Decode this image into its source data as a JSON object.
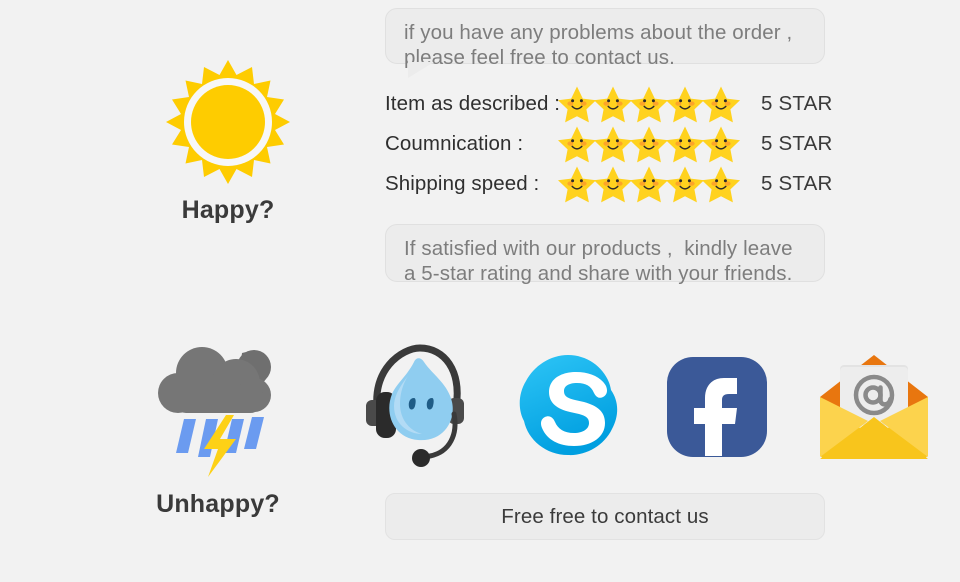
{
  "page": {
    "background_color": "#f2f2f2"
  },
  "top_bubble": {
    "name": "problems-notice",
    "line1": "if you have any problems about the order ,",
    "line2": "please feel free to contact us."
  },
  "mood": {
    "happy": {
      "label": "Happy?",
      "icon": "sun-icon",
      "color": "#fecc00"
    },
    "unhappy": {
      "label": "Unhappy?",
      "icon": "storm-cloud-rain-icon",
      "cloud_color": "#767676",
      "rain_color": "#6b9bf0",
      "bolt_color": "#fdd116"
    }
  },
  "ratings": {
    "star_glyph": "smiling-star-icon",
    "star_count": 5,
    "star_color": "#ffd21e",
    "rows": [
      {
        "label": "Item as described :",
        "stars": 5,
        "value": "5 STAR"
      },
      {
        "label": "Coumnication :",
        "stars": 5,
        "value": "5 STAR"
      },
      {
        "label": "Shipping speed :",
        "stars": 5,
        "value": "5 STAR"
      }
    ]
  },
  "mid_bubble": {
    "name": "rating-request",
    "line1": "If satisfied with our products ,  kindly leave",
    "line2": "a 5-star rating and share with your friends."
  },
  "contacts": [
    {
      "name": "trademanager-icon",
      "label": "TradeManager",
      "color": "#7ec8ee"
    },
    {
      "name": "skype-icon",
      "label": "Skype",
      "color": "#00aff0"
    },
    {
      "name": "facebook-icon",
      "label": "Facebook",
      "color": "#3b5998"
    },
    {
      "name": "email-icon",
      "label": "Email",
      "color": "#f8c51c"
    }
  ],
  "footer_button": {
    "label": "Free free to contact us"
  }
}
